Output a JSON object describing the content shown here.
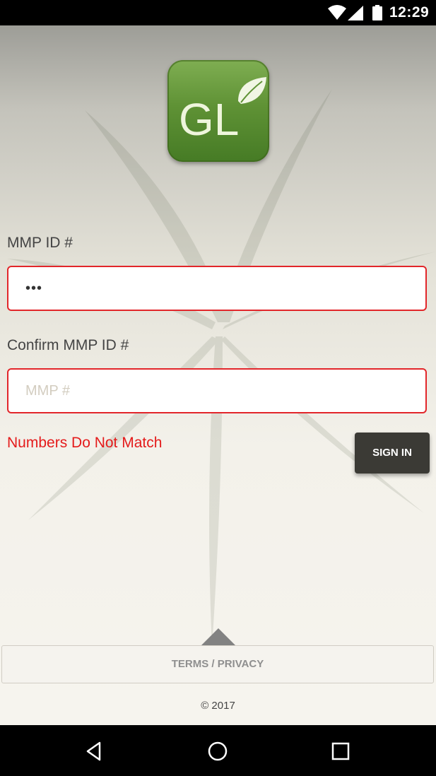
{
  "status_bar": {
    "time": "12:29",
    "icons": [
      "wifi-icon",
      "cell-signal-icon",
      "battery-icon"
    ]
  },
  "logo": {
    "text": "GL",
    "icon": "leaf-icon",
    "colors": {
      "green": "#5f9235",
      "leaf": "#f1f6e4"
    }
  },
  "form": {
    "mmp_label": "MMP ID #",
    "mmp_value": "•••",
    "confirm_label": "Confirm MMP ID #",
    "confirm_placeholder": "MMP #",
    "confirm_value": "",
    "error_text": "Numbers Do Not Match",
    "signin_label": "SIGN IN",
    "error_color": "#e2262a"
  },
  "footer": {
    "links_label": "TERMS / PRIVACY",
    "copyright": "© 2017",
    "caret_icon": "caret-up-icon"
  },
  "nav": {
    "icons": [
      "back-icon",
      "home-icon",
      "recent-apps-icon"
    ]
  }
}
